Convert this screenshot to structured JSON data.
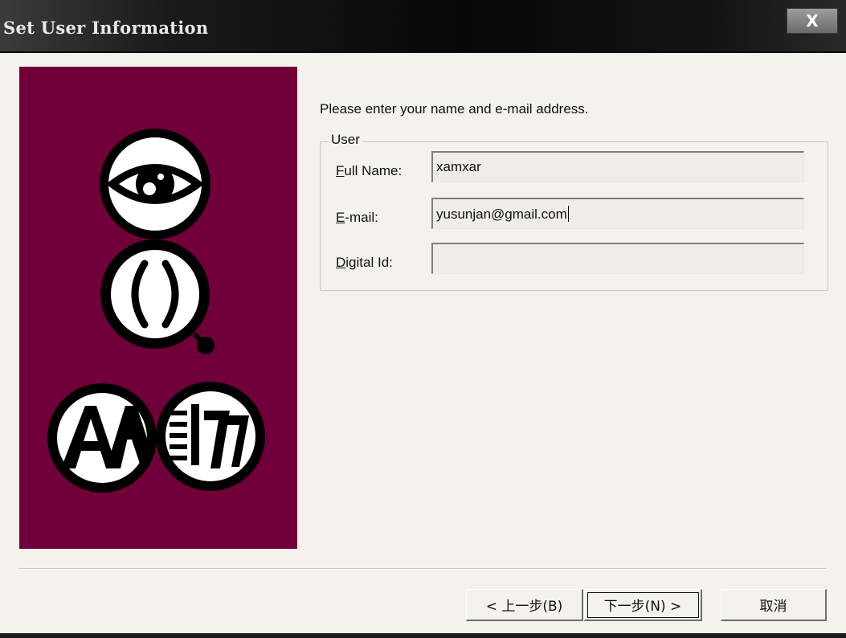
{
  "window": {
    "title": "Set User Information",
    "close_label": "X"
  },
  "instruction": "Please enter your name and e-mail address.",
  "user_group": {
    "legend": "User",
    "fields": {
      "full_name": {
        "label_accel": "F",
        "label_rest": "ull Name:",
        "value": "xamxar"
      },
      "email": {
        "label_accel": "E",
        "label_rest": "-mail:",
        "value": "yusunjan@gmail.com"
      },
      "digital_id": {
        "label_accel": "D",
        "label_rest": "igital Id:",
        "value": ""
      }
    }
  },
  "buttons": {
    "back": "< 上一步(B)",
    "next": "下一步(N) >",
    "cancel": "取消"
  },
  "colors": {
    "panel": "#71003a",
    "background": "#f3f2ec"
  },
  "icons": [
    "eye-icon",
    "magnifier-icon",
    "font-icon",
    "document-icon"
  ]
}
